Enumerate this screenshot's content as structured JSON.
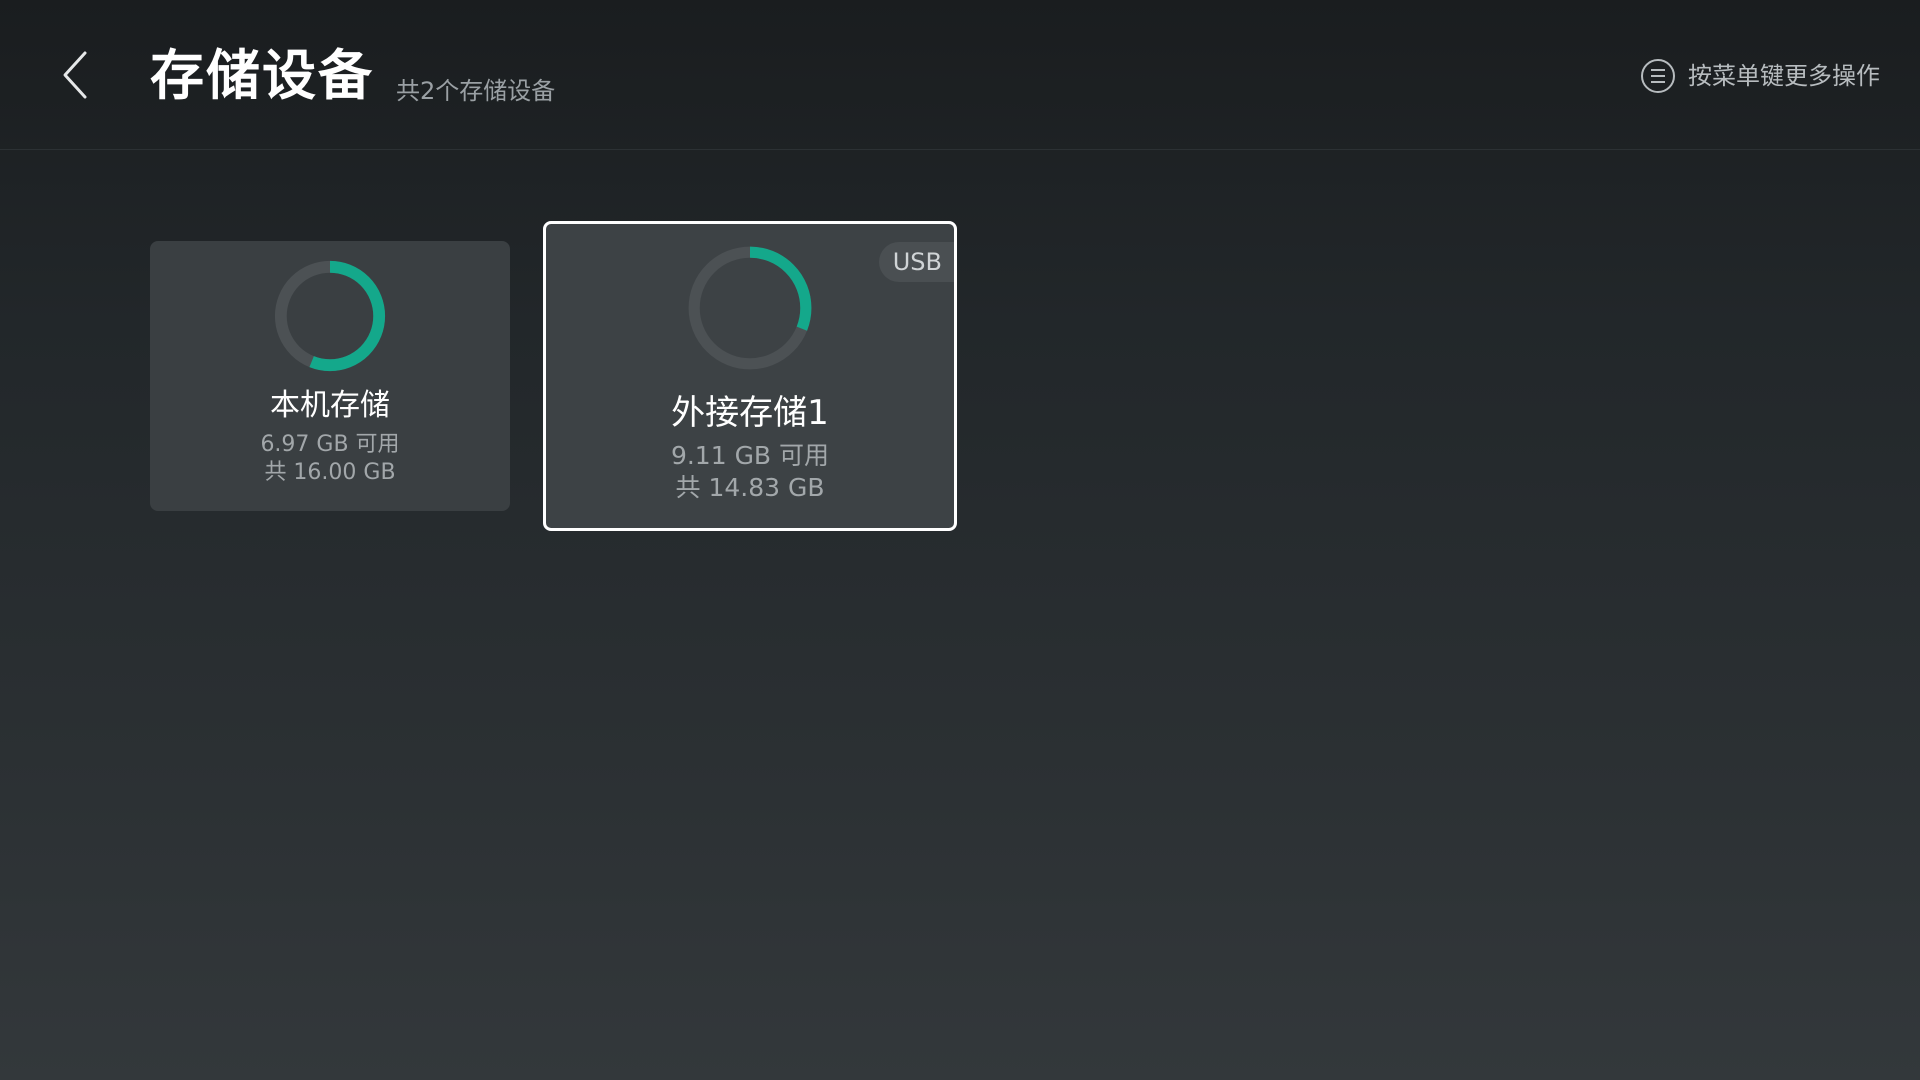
{
  "header": {
    "title": "存储设备",
    "subtitle": "共2个存储设备",
    "menu_hint": "按菜单键更多操作"
  },
  "icons": {
    "back": "chevron-left-icon",
    "menu": "menu-circle-icon"
  },
  "colors": {
    "accent": "#14a88b",
    "ring_track": "#4c5154",
    "focus_border": "#ffffff"
  },
  "devices": [
    {
      "name": "本机存储",
      "available": "6.97 GB 可用",
      "total": "共 16.00 GB",
      "badge": "",
      "used_fraction": 0.56,
      "focused": false
    },
    {
      "name": "外接存储1",
      "available": "9.11 GB 可用",
      "total": "共 14.83 GB",
      "badge": "USB",
      "used_fraction": 0.31,
      "focused": true
    }
  ]
}
